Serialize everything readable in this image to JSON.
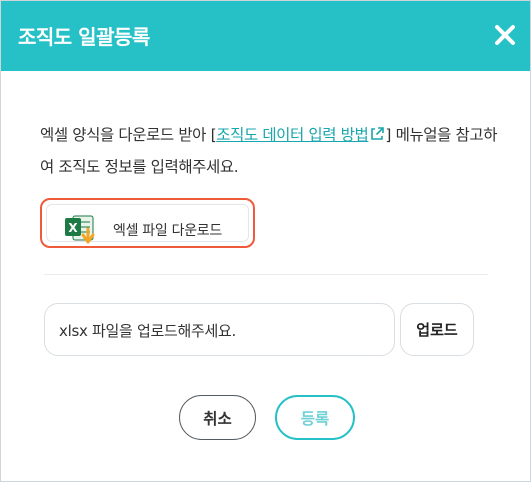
{
  "dialog": {
    "title": "조직도 일괄등록",
    "close_icon": "close-icon",
    "header_color": "#26c0c7"
  },
  "description": {
    "before_link": "엑셀 양식을 다운로드 받아 [",
    "link_text": "조직도 데이터 입력 방법",
    "link_icon": "external-link-icon",
    "after_link": "] 메뉴얼을 참고하여 조직도 정보를 입력해주세요."
  },
  "download": {
    "label": "엑셀 파일 다운로드",
    "icon": "excel-download-icon",
    "highlight_color": "#ee5a3a"
  },
  "upload": {
    "field_text": "xlsx 파일을 업로드해주세요.",
    "button_label": "업로드"
  },
  "actions": {
    "cancel_label": "취소",
    "register_label": "등록"
  }
}
